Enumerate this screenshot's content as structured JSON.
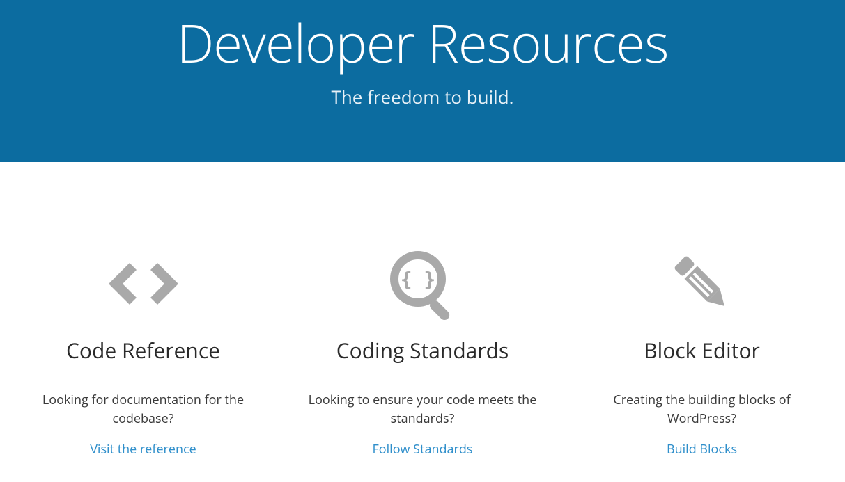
{
  "hero": {
    "title": "Developer Resources",
    "subtitle": "The freedom to build."
  },
  "cards": [
    {
      "icon": "code-icon",
      "title": "Code Reference",
      "description": "Looking for documentation for the codebase?",
      "link_label": "Visit the reference"
    },
    {
      "icon": "standards-icon",
      "title": "Coding Standards",
      "description": "Looking to ensure your code meets the standards?",
      "link_label": "Follow Standards"
    },
    {
      "icon": "pencil-icon",
      "title": "Block Editor",
      "description": "Creating the building blocks of WordPress?",
      "link_label": "Build Blocks"
    }
  ],
  "colors": {
    "hero_bg": "#0c6ca0",
    "link": "#2f8fcb",
    "icon": "#a9a9a9"
  }
}
